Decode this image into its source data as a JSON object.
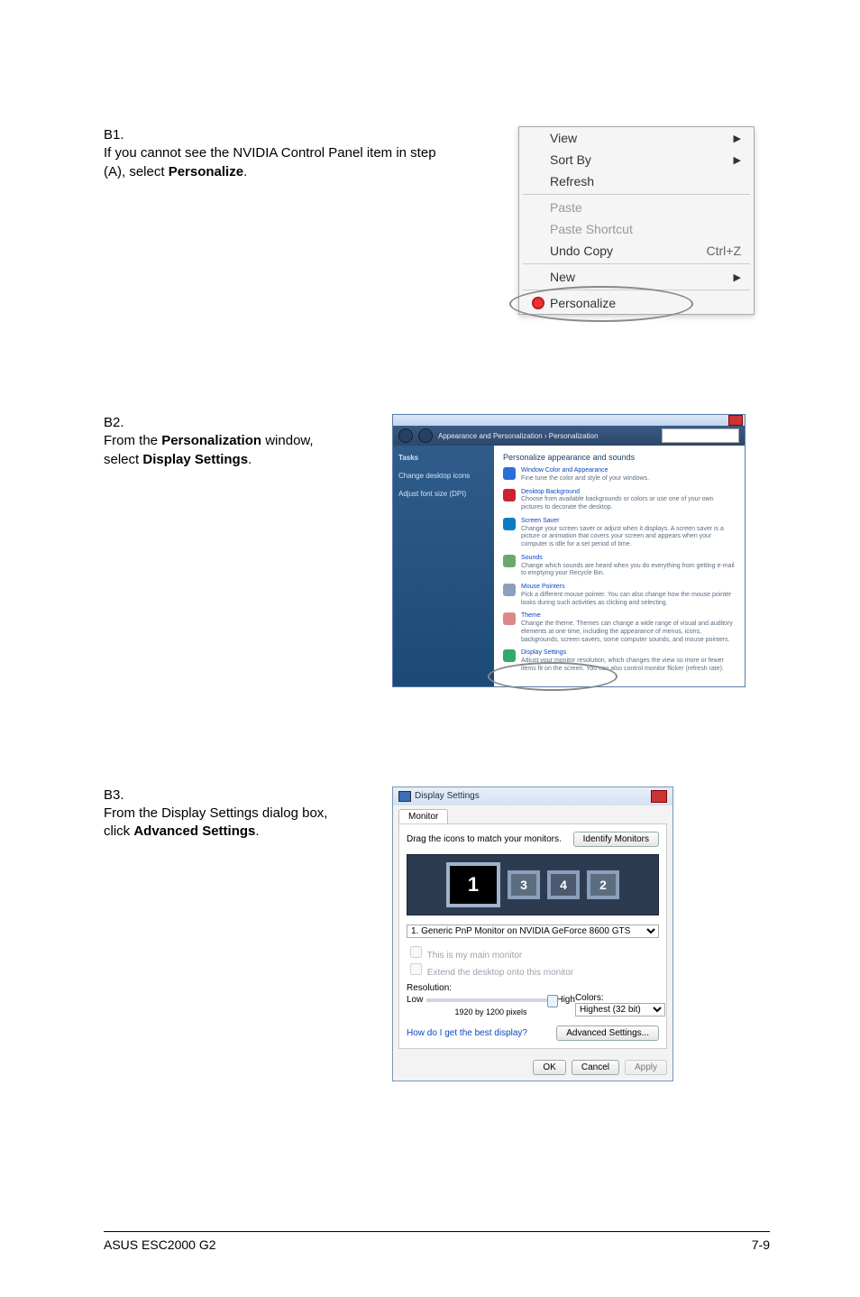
{
  "b1": {
    "num": "B1.",
    "text_pre": "If you cannot see the NVIDIA Control Panel item in step (A), select ",
    "text_bold": "Personalize",
    "text_post": "."
  },
  "ctxmenu": {
    "view": "View",
    "sortby": "Sort By",
    "refresh": "Refresh",
    "paste": "Paste",
    "paste_shortcut": "Paste Shortcut",
    "undo_copy": "Undo Copy",
    "undo_copy_accel": "Ctrl+Z",
    "new": "New",
    "personalize": "Personalize"
  },
  "b2": {
    "num": "B2.",
    "text_pre": "From the ",
    "text_bold1": "Personalization",
    "text_mid": " window, select ",
    "text_bold2": "Display Settings",
    "text_post": "."
  },
  "pwin": {
    "crumb": "Appearance and Personalization › Personalization",
    "side_tasks": "Tasks",
    "side_item1": "Change desktop icons",
    "side_item2": "Adjust font size (DPI)",
    "hdr": "Personalize appearance and sounds",
    "e1_title": "Window Color and Appearance",
    "e1_desc": "Fine tune the color and style of your windows.",
    "e2_title": "Desktop Background",
    "e2_desc": "Choose from available backgrounds or colors or use one of your own pictures to decorate the desktop.",
    "e3_title": "Screen Saver",
    "e3_desc": "Change your screen saver or adjust when it displays. A screen saver is a picture or animation that covers your screen and appears when your computer is idle for a set period of time.",
    "e4_title": "Sounds",
    "e4_desc": "Change which sounds are heard when you do everything from getting e-mail to emptying your Recycle Bin.",
    "e5_title": "Mouse Pointers",
    "e5_desc": "Pick a different mouse pointer. You can also change how the mouse pointer looks during such activities as clicking and selecting.",
    "e6_title": "Theme",
    "e6_desc": "Change the theme. Themes can change a wide range of visual and auditory elements at one time, including the appearance of menus, icons, backgrounds, screen savers, some computer sounds, and mouse pointers.",
    "e7_title": "Display Settings",
    "e7_desc": "Adjust your monitor resolution, which changes the view so more or fewer items fit on the screen. You can also control monitor flicker (refresh rate)."
  },
  "b3": {
    "num": "B3.",
    "text_pre": "From the Display Settings dialog box, click ",
    "text_bold": "Advanced Settings",
    "text_post": "."
  },
  "ds": {
    "title": "Display Settings",
    "tab": "Monitor",
    "drag": "Drag the icons to match your monitors.",
    "identify": "Identify Monitors",
    "mon1": "1",
    "mon3": "3",
    "mon4": "4",
    "mon2": "2",
    "select": "1. Generic PnP Monitor on NVIDIA GeForce 8600 GTS",
    "chk_main": "This is my main monitor",
    "chk_extend": "Extend the desktop onto this monitor",
    "res_label": "Resolution:",
    "low": "Low",
    "high": "High",
    "res_val": "1920 by 1200 pixels",
    "colors_label": "Colors:",
    "colors_val": "Highest (32 bit)",
    "help": "How do I get the best display?",
    "adv": "Advanced Settings...",
    "ok": "OK",
    "cancel": "Cancel",
    "apply": "Apply"
  },
  "footer": {
    "left": "ASUS ESC2000 G2",
    "right": "7-9"
  }
}
